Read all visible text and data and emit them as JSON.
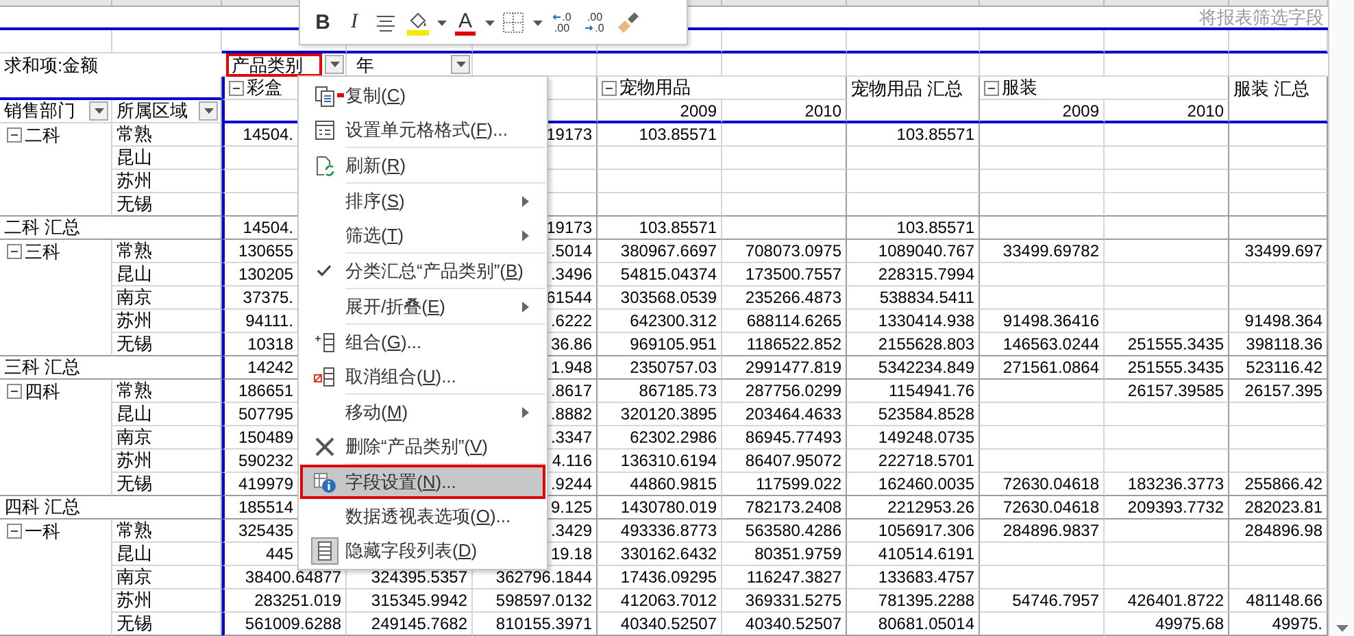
{
  "mini_toolbar": {
    "buttons": [
      {
        "kind": "bold",
        "label": "B"
      },
      {
        "kind": "italic",
        "label": "I"
      },
      {
        "kind": "align"
      },
      {
        "kind": "fill_color"
      },
      {
        "kind": "dropdown"
      },
      {
        "kind": "font_color",
        "label": "A"
      },
      {
        "kind": "dropdown"
      },
      {
        "kind": "borders"
      },
      {
        "kind": "dropdown"
      },
      {
        "kind": "increase_decimal",
        "top": ".0",
        "bottom": ".00"
      },
      {
        "kind": "decrease_decimal",
        "top": ".00",
        "bottom": ".0"
      },
      {
        "kind": "format_painter"
      }
    ]
  },
  "hint": "将报表筛选字段",
  "pivot": {
    "value_field": "求和项:金额",
    "column_fields": [
      {
        "label": "产品类别",
        "annotated": true
      },
      {
        "label": "年",
        "annotated": false
      }
    ],
    "row_fields": [
      "销售部门",
      "所属区域"
    ],
    "categories": [
      {
        "label": "彩盒"
      },
      {
        "label": "宠物用品",
        "years": [
          "2009",
          "2010"
        ],
        "total": "宠物用品 汇总"
      },
      {
        "label": "服装",
        "years": [
          "2009",
          "2010"
        ],
        "total": "服装 汇总"
      }
    ],
    "groups": [
      {
        "dept": "二科",
        "rows": [
          {
            "region": "常熟",
            "cells": {
              "column_3": "14504.",
              "column_5": "19173",
              "column_6": "103.85571",
              "column_8": "103.85571"
            }
          },
          {
            "region": "昆山",
            "cells": {}
          },
          {
            "region": "苏州",
            "cells": {}
          },
          {
            "region": "无锡",
            "cells": {}
          }
        ],
        "total": {
          "label": "二科 汇总",
          "cells": {
            "column_3": "14504.",
            "column_5": "19173",
            "column_6": "103.85571",
            "column_8": "103.85571"
          }
        }
      },
      {
        "dept": "三科",
        "rows": [
          {
            "region": "常熟",
            "cells": {
              "column_3": "130655",
              "column_5": ".5014",
              "column_6": "380967.6697",
              "column_7": "708073.0975",
              "column_8": "1089040.767",
              "column_9": "33499.69782",
              "column_11": "33499.697"
            }
          },
          {
            "region": "昆山",
            "cells": {
              "column_3": "130205",
              "column_5": ".3496",
              "column_6": "54815.04374",
              "column_7": "173500.7557",
              "column_8": "228315.7994"
            }
          },
          {
            "region": "南京",
            "cells": {
              "column_3": "37375.",
              "column_5": "61544",
              "column_6": "303568.0539",
              "column_7": "235266.4873",
              "column_8": "538834.5411"
            }
          },
          {
            "region": "苏州",
            "cells": {
              "column_3": "94111.",
              "column_5": ".6222",
              "column_6": "642300.312",
              "column_7": "688114.6265",
              "column_8": "1330414.938",
              "column_9": "91498.36416",
              "column_11": "91498.364"
            }
          },
          {
            "region": "无锡",
            "cells": {
              "column_3": "10318",
              "column_5": "36.86",
              "column_6": "969105.951",
              "column_7": "1186522.852",
              "column_8": "2155628.803",
              "column_9": "146563.0244",
              "column_10": "251555.3435",
              "column_11": "398118.36"
            }
          }
        ],
        "total": {
          "label": "三科 汇总",
          "cells": {
            "column_3": "14242",
            "column_5": "1.948",
            "column_6": "2350757.03",
            "column_7": "2991477.819",
            "column_8": "5342234.849",
            "column_9": "271561.0864",
            "column_10": "251555.3435",
            "column_11": "523116.42"
          }
        }
      },
      {
        "dept": "四科",
        "rows": [
          {
            "region": "常熟",
            "cells": {
              "column_3": "186651",
              "column_5": ".8617",
              "column_6": "867185.73",
              "column_7": "287756.0299",
              "column_8": "1154941.76",
              "column_10": "26157.39585",
              "column_11": "26157.395"
            }
          },
          {
            "region": "昆山",
            "cells": {
              "column_3": "507795",
              "column_5": ".8882",
              "column_6": "320120.3895",
              "column_7": "203464.4633",
              "column_8": "523584.8528"
            }
          },
          {
            "region": "南京",
            "cells": {
              "column_3": "150489",
              "column_5": ".3347",
              "column_6": "62302.2986",
              "column_7": "86945.77493",
              "column_8": "149248.0735"
            }
          },
          {
            "region": "苏州",
            "cells": {
              "column_3": "590232",
              "column_5": "4.116",
              "column_6": "136310.6194",
              "column_7": "86407.95072",
              "column_8": "222718.5701"
            }
          },
          {
            "region": "无锡",
            "cells": {
              "column_3": "419979",
              "column_5": ".9244",
              "column_6": "44860.9815",
              "column_7": "117599.022",
              "column_8": "162460.0035",
              "column_9": "72630.04618",
              "column_10": "183236.3773",
              "column_11": "255866.42"
            }
          }
        ],
        "total": {
          "label": "四科 汇总",
          "cells": {
            "column_3": "185514",
            "column_5": "9.125",
            "column_6": "1430780.019",
            "column_7": "782173.2408",
            "column_8": "2212953.26",
            "column_9": "72630.04618",
            "column_10": "209393.7732",
            "column_11": "282023.81"
          }
        }
      },
      {
        "dept": "一科",
        "rows": [
          {
            "region": "常熟",
            "cells": {
              "column_3": "325435",
              "column_5": ".3429",
              "column_6": "493336.8773",
              "column_7": "563580.4286",
              "column_8": "1056917.306",
              "column_9": "284896.9837",
              "column_11": "284896.98"
            }
          },
          {
            "region": "昆山",
            "cells": {
              "column_3": "445",
              "column_5": "19.18",
              "column_6": "330162.6432",
              "column_7": "80351.9759",
              "column_8": "410514.6191"
            }
          },
          {
            "region": "南京",
            "cells": {
              "column_3": "38400.64877",
              "column_4": "324395.5357",
              "column_5": "362796.1844",
              "column_6": "17436.09295",
              "column_7": "116247.3827",
              "column_8": "133683.4757"
            }
          },
          {
            "region": "苏州",
            "cells": {
              "column_3": "283251.019",
              "column_4": "315345.9942",
              "column_5": "598597.0132",
              "column_6": "412063.7012",
              "column_7": "369331.5275",
              "column_8": "781395.2288",
              "column_9": "54746.7957",
              "column_10": "426401.8722",
              "column_11": "481148.66"
            }
          },
          {
            "region": "无锡",
            "cells": {
              "column_3": "561009.6288",
              "column_4": "249145.7682",
              "column_5": "810155.3971",
              "column_6": "40340.52507",
              "column_7": "40340.52507",
              "column_8": "80681.05014",
              "column_10": "49975.68",
              "column_11": "49975."
            }
          }
        ]
      }
    ]
  },
  "menu": {
    "groups": [
      [
        {
          "parts": [
            "复制(",
            "C",
            ")"
          ],
          "kind": "copy",
          "checked": false,
          "selected": false,
          "annotated": false
        },
        {
          "parts": [
            "设置单元格格式(",
            "F",
            ")..."
          ],
          "kind": "format",
          "checked": false,
          "selected": false,
          "annotated": false
        }
      ],
      [
        {
          "parts": [
            "刷新(",
            "R",
            ")"
          ],
          "kind": "refresh",
          "checked": false,
          "selected": false,
          "annotated": false
        }
      ],
      [
        {
          "parts": [
            "排序(",
            "S",
            ")"
          ],
          "kind": "submenu",
          "checked": false,
          "selected": false,
          "annotated": false
        },
        {
          "parts": [
            "筛选(",
            "T",
            ")"
          ],
          "kind": "submenu",
          "checked": false,
          "selected": false,
          "annotated": false
        }
      ],
      [
        {
          "parts": [
            "分类汇总“产品类别”(",
            "B",
            ")"
          ],
          "kind": "plain",
          "checked": true,
          "selected": false,
          "annotated": false
        }
      ],
      [
        {
          "parts": [
            "展开/折叠(",
            "E",
            ")"
          ],
          "kind": "submenu",
          "checked": false,
          "selected": false,
          "annotated": false
        }
      ],
      [
        {
          "parts": [
            "组合(",
            "G",
            ")..."
          ],
          "kind": "group",
          "checked": false,
          "selected": false,
          "annotated": false
        },
        {
          "parts": [
            "取消组合(",
            "U",
            ")..."
          ],
          "kind": "ungroup",
          "checked": false,
          "selected": false,
          "annotated": false
        }
      ],
      [
        {
          "parts": [
            "移动(",
            "M",
            ")"
          ],
          "kind": "submenu",
          "checked": false,
          "selected": false,
          "annotated": false
        },
        {
          "parts": [
            "删除“产品类别”(",
            "V",
            ")"
          ],
          "kind": "delete",
          "checked": false,
          "selected": false,
          "annotated": false
        }
      ],
      [
        {
          "parts": [
            "字段设置(",
            "N",
            ")..."
          ],
          "kind": "field_settings",
          "checked": false,
          "selected": true,
          "annotated": true
        },
        {
          "parts": [
            "数据透视表选项(",
            "O",
            ")..."
          ],
          "kind": "plain",
          "checked": false,
          "selected": false,
          "annotated": false
        },
        {
          "parts": [
            "隐藏字段列表(",
            "D",
            ")"
          ],
          "kind": "field_list",
          "checked": false,
          "selected": false,
          "annotated": false
        }
      ]
    ]
  }
}
